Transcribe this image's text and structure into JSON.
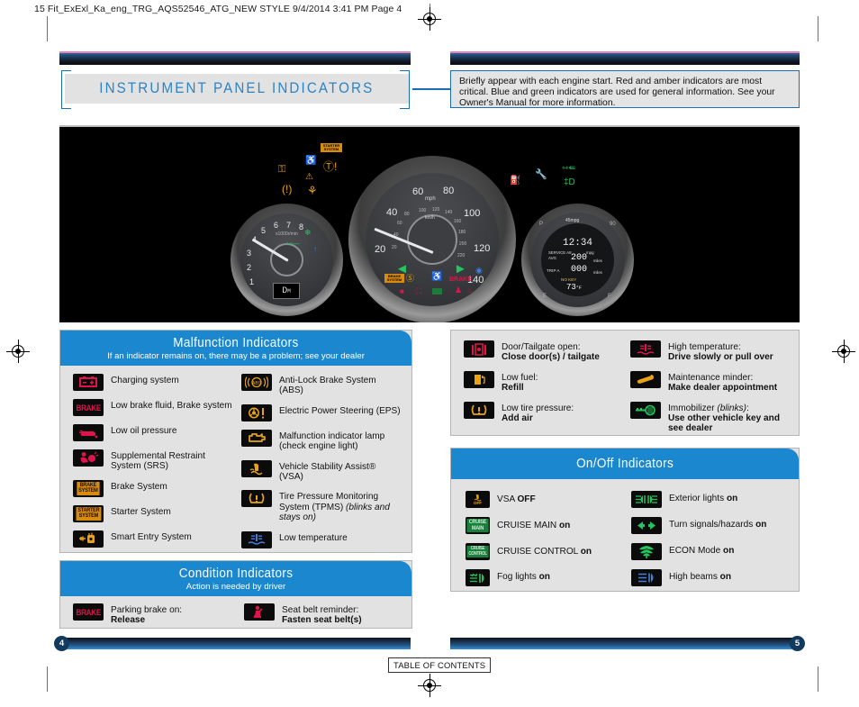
{
  "print_header": "15 Fit_ExExl_Ka_eng_TRG_AQS52546_ATG_NEW STYLE  9/4/2014  3:41 PM  Page 4",
  "title": "INSTRUMENT PANEL INDICATORS",
  "info_note": "Briefly appear with each engine start. Red and amber indicators are most critical. Blue and green indicators are used for general information. See your Owner's Manual for more information.",
  "colors": {
    "accent_blue": "#1a87cf",
    "panel_bg": "#e2e2e2",
    "rule_pink": "#ef7fb2",
    "red_icon": "#e0144c",
    "amber_icon": "#e8a317",
    "green_icon": "#22c55e",
    "blue_icon": "#3f7fe0"
  },
  "cluster": {
    "tachometer": {
      "ticks": [
        "1",
        "2",
        "3",
        "4",
        "5",
        "6",
        "7",
        "8"
      ],
      "unit": "x1000r/min",
      "gear_display": "D",
      "gear_mode": "M"
    },
    "speedometer": {
      "mph_ticks": [
        "20",
        "40",
        "60",
        "80",
        "100",
        "120",
        "140"
      ],
      "mph_label": "mph",
      "kmh_label": "km/h",
      "kmh_ticks": [
        "20",
        "40",
        "60",
        "80",
        "100",
        "120",
        "140",
        "160",
        "180",
        "200",
        "220"
      ]
    },
    "info_display": {
      "top_label": "45mpg",
      "clock": "12:34",
      "service_label": "SERVICE A8",
      "mpg_label": "mpg",
      "avg_label": "AVG",
      "avg_value": "200",
      "avg_unit": "miles",
      "trip_label": "TRIP A",
      "trip_value": "000",
      "trip_unit": "miles",
      "key_label": "NO KEY",
      "key_sub": "(bar)",
      "temp": "73",
      "temp_unit": "°F",
      "fuel_e": "E",
      "fuel_f": "F",
      "left_gauge": "P",
      "right_gauge": "90"
    }
  },
  "malfunction": {
    "title": "Malfunction Indicators",
    "subtitle": "If an indicator remains on, there may be a problem; see your dealer",
    "left_items": [
      {
        "icon": "battery-charging-icon",
        "label": "Charging system"
      },
      {
        "icon": "brake-word-icon",
        "label": "Low brake fluid, Brake system"
      },
      {
        "icon": "oil-pressure-icon",
        "label": "Low oil pressure"
      },
      {
        "icon": "srs-airbag-icon",
        "label": "Supplemental Restraint System (SRS)"
      },
      {
        "icon": "brake-system-word-icon",
        "label": "Brake System"
      },
      {
        "icon": "starter-system-word-icon",
        "label": "Starter System"
      },
      {
        "icon": "smart-entry-icon",
        "label": "Smart Entry System"
      }
    ],
    "right_items": [
      {
        "icon": "abs-icon",
        "label": "Anti-Lock Brake System (ABS)"
      },
      {
        "icon": "eps-icon",
        "label": "Electric Power Steering (EPS)"
      },
      {
        "icon": "check-engine-icon",
        "label": "Malfunction indicator lamp (check engine light)"
      },
      {
        "icon": "vsa-icon",
        "label": "Vehicle Stability Assist® (VSA)"
      },
      {
        "icon": "tpms-icon",
        "label": "Tire Pressure Monitoring System (TPMS) ",
        "italic": "(blinks and stays on)"
      },
      {
        "icon": "low-temperature-icon",
        "label": "Low temperature"
      }
    ]
  },
  "condition": {
    "title": "Condition Indicators",
    "subtitle": "Action is needed by driver",
    "items": [
      {
        "icon": "brake-word-icon",
        "label": "Parking brake on:",
        "action": "Release"
      },
      {
        "icon": "seatbelt-icon",
        "label": "Seat belt reminder:",
        "action": "Fasten seat belt(s)"
      }
    ]
  },
  "action_panel": {
    "left_items": [
      {
        "icon": "door-open-icon",
        "label": "Door/Tailgate open:",
        "action": "Close door(s) / tailgate"
      },
      {
        "icon": "low-fuel-icon",
        "label": "Low fuel:",
        "action": "Refill"
      },
      {
        "icon": "tpms-icon",
        "label": "Low tire pressure:",
        "action": "Add air"
      }
    ],
    "right_items": [
      {
        "icon": "high-temperature-icon",
        "label": "High temperature:",
        "action": "Drive slowly or pull over"
      },
      {
        "icon": "wrench-icon",
        "label": "Maintenance minder:",
        "action": "Make dealer appointment"
      },
      {
        "icon": "immobilizer-key-icon",
        "label": "Immobilizer ",
        "italic": "(blinks)",
        "label_end": ":",
        "action": "Use other vehicle key and see dealer"
      }
    ]
  },
  "onoff": {
    "title": "On/Off Indicators",
    "left_items": [
      {
        "icon": "vsa-off-icon",
        "label": "VSA ",
        "bold": "OFF"
      },
      {
        "icon": "cruise-main-icon",
        "label": "CRUISE MAIN ",
        "bold": "on"
      },
      {
        "icon": "cruise-control-icon",
        "label": "CRUISE CONTROL ",
        "bold": "on"
      },
      {
        "icon": "fog-lights-icon",
        "label": "Fog lights ",
        "bold": "on"
      }
    ],
    "right_items": [
      {
        "icon": "exterior-lights-icon",
        "label": "Exterior lights ",
        "bold": "on"
      },
      {
        "icon": "turn-signal-icon",
        "label": "Turn signals/hazards ",
        "bold": "on"
      },
      {
        "icon": "econ-mode-icon",
        "label": "ECON Mode ",
        "bold": "on"
      },
      {
        "icon": "high-beams-icon",
        "label": "High beams ",
        "bold": "on"
      }
    ]
  },
  "footer": {
    "page_left": "4",
    "page_right": "5",
    "toc_label": "TABLE OF CONTENTS"
  },
  "icon_glyphs": {
    "battery-charging-icon": "− +",
    "brake-word-icon": "BRAKE",
    "brake-system-word-icon": "BRAKE SYSTEM",
    "starter-system-word-icon": "STARTER SYSTEM",
    "cruise-main-icon": "CRUISE MAIN",
    "cruise-control-icon": "CRUISE CONTROL",
    "vsa-off-icon": "OFF",
    "abs-icon": "ABS"
  }
}
